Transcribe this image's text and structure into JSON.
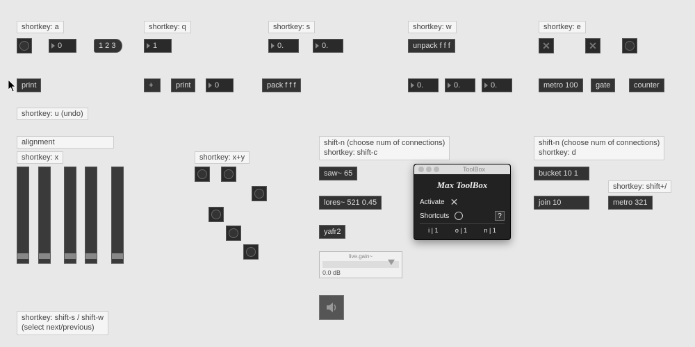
{
  "section_a": {
    "label": "shortkey: a",
    "num1": "0",
    "msg123": "1 2 3",
    "print": "print"
  },
  "section_q": {
    "label": "shortkey: q",
    "num1": "1",
    "plus": "+",
    "print": "print",
    "num_out": "0"
  },
  "section_s": {
    "label": "shortkey: s",
    "f1": "0.",
    "f2": "0.",
    "pack": "pack f f f"
  },
  "section_w": {
    "label": "shortkey: w",
    "unpack": "unpack f f f",
    "f1": "0.",
    "f2": "0.",
    "f3": "0."
  },
  "section_e": {
    "label": "shortkey: e",
    "metro": "metro 100",
    "gate": "gate",
    "counter": "counter"
  },
  "undo": {
    "label": "shortkey: u (undo)"
  },
  "alignment": {
    "label": "alignment"
  },
  "section_x": {
    "label": "shortkey: x"
  },
  "section_xy": {
    "label": "shortkey: x+y"
  },
  "select_np": {
    "label": "shortkey: shift-s / shift-w\n(select next/previous)"
  },
  "section_c": {
    "label_top": "shift-n (choose num of connections)",
    "label_bot": "shortkey: shift-c",
    "saw": "saw~ 65",
    "lores": "lores~ 521 0.45",
    "yafr": "yafr2",
    "gain_title": "live.gain~",
    "gain_db": "0.0 dB"
  },
  "section_d": {
    "label_top": "shift-n (choose num of connections)",
    "label_bot": "shortkey: d",
    "bucket": "bucket 10 1",
    "join": "join 10",
    "shiftplus": "shortkey: shift+/",
    "metro": "metro 321"
  },
  "toolbox": {
    "window_title": "ToolBox",
    "heading": "Max ToolBox",
    "activate": "Activate",
    "shortcuts": "Shortcuts",
    "help": "?",
    "i": "i | 1",
    "o": "o | 1",
    "n": "n | 1"
  }
}
